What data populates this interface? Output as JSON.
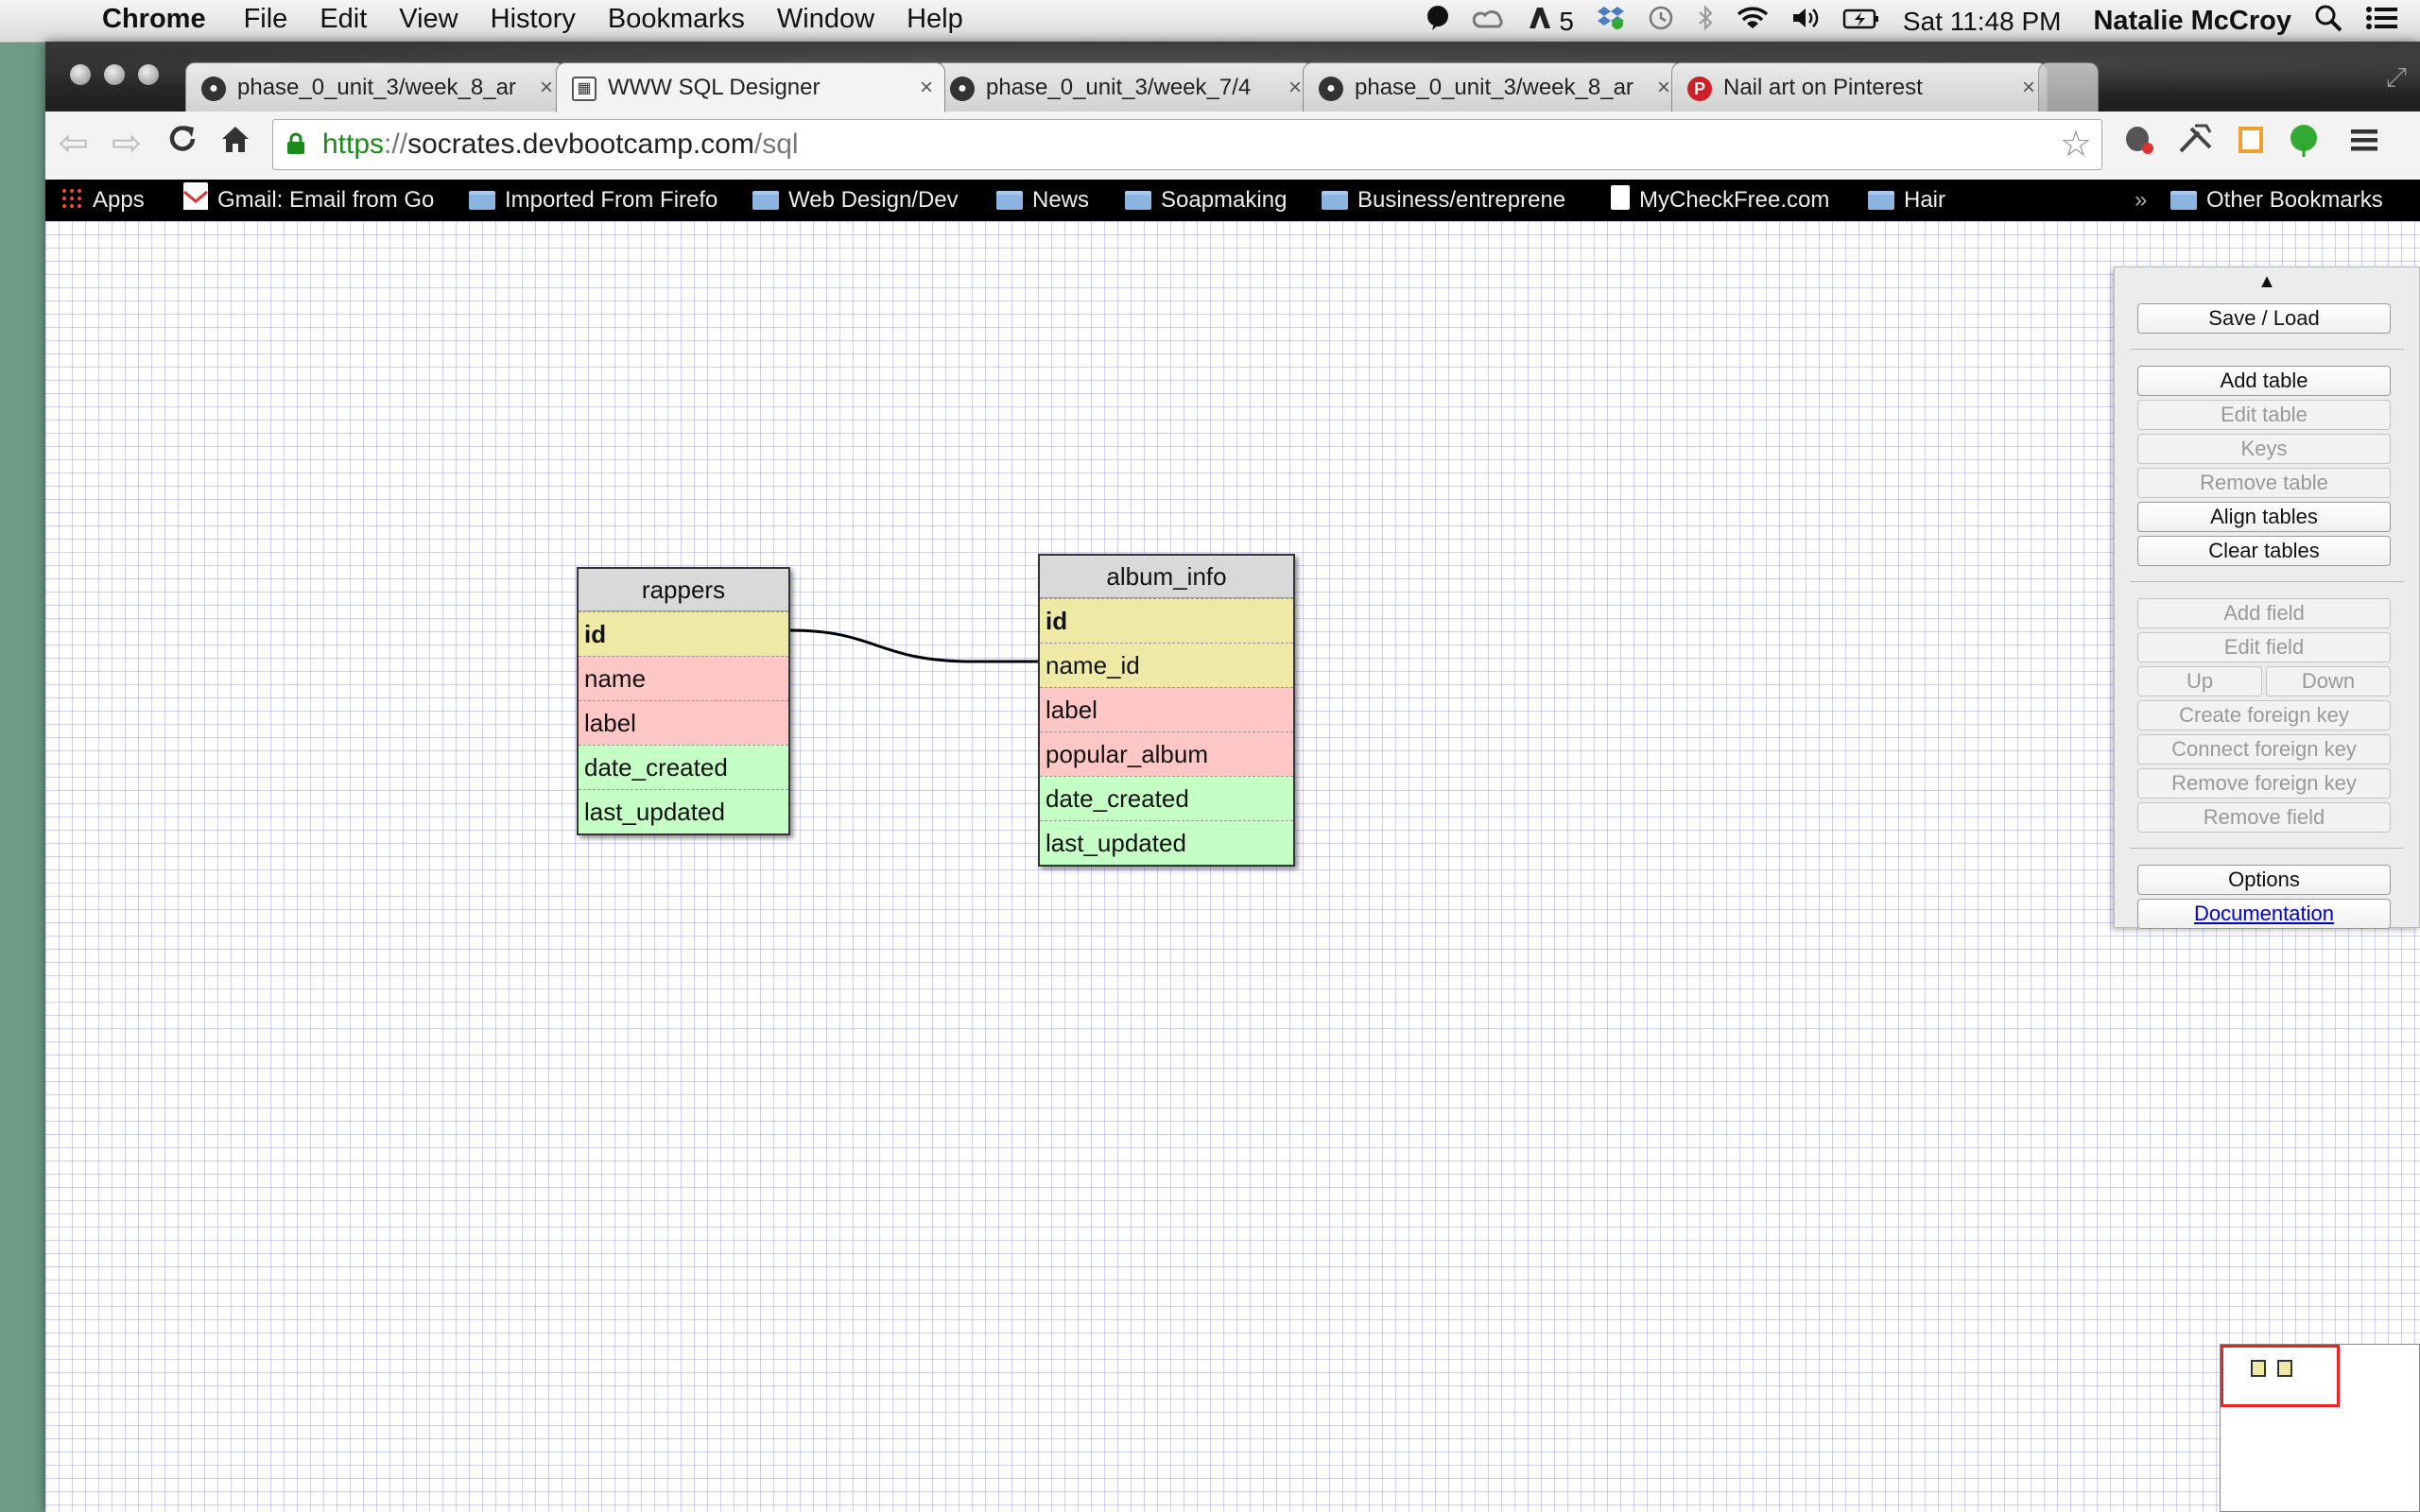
{
  "menubar": {
    "app": "Chrome",
    "menus": [
      "File",
      "Edit",
      "View",
      "History",
      "Bookmarks",
      "Window",
      "Help"
    ],
    "adobe_count": "5",
    "clock": "Sat 11:48 PM",
    "user": "Natalie McCroy"
  },
  "tabs": [
    {
      "title": "phase_0_unit_3/week_8_ar",
      "icon": "github-icon",
      "active": false
    },
    {
      "title": "WWW SQL Designer",
      "icon": "sql-designer-icon",
      "active": true
    },
    {
      "title": "phase_0_unit_3/week_7/4",
      "icon": "github-icon",
      "active": false
    },
    {
      "title": "phase_0_unit_3/week_8_ar",
      "icon": "github-icon",
      "active": false
    },
    {
      "title": "Nail art on Pinterest",
      "icon": "pinterest-icon",
      "active": false
    }
  ],
  "omnibox": {
    "scheme": "https",
    "separator": "://",
    "host": "socrates.devbootcamp.com",
    "path": "/sql"
  },
  "bookmarks": {
    "items": [
      {
        "label": "Apps",
        "icon": "apps-grid-icon"
      },
      {
        "label": "Gmail: Email from Go",
        "icon": "gmail-icon"
      },
      {
        "label": "Imported From Firefo",
        "icon": "folder-icon"
      },
      {
        "label": "Web Design/Dev",
        "icon": "folder-icon"
      },
      {
        "label": "News",
        "icon": "folder-icon"
      },
      {
        "label": "Soapmaking",
        "icon": "folder-icon"
      },
      {
        "label": "Business/entreprene",
        "icon": "folder-icon"
      },
      {
        "label": "MyCheckFree.com",
        "icon": "page-icon"
      },
      {
        "label": "Hair",
        "icon": "folder-icon"
      }
    ],
    "overflow": "»",
    "other": "Other Bookmarks"
  },
  "tables": [
    {
      "name": "rappers",
      "fields": [
        {
          "name": "id",
          "kind": "key"
        },
        {
          "name": "name",
          "kind": "text"
        },
        {
          "name": "label",
          "kind": "text"
        },
        {
          "name": "date_created",
          "kind": "date"
        },
        {
          "name": "last_updated",
          "kind": "date"
        }
      ]
    },
    {
      "name": "album_info",
      "fields": [
        {
          "name": "id",
          "kind": "key"
        },
        {
          "name": "name_id",
          "kind": "foreign"
        },
        {
          "name": "label",
          "kind": "text"
        },
        {
          "name": "popular_album",
          "kind": "text"
        },
        {
          "name": "date_created",
          "kind": "date"
        },
        {
          "name": "last_updated",
          "kind": "date"
        }
      ]
    }
  ],
  "panel": {
    "save_load": "Save / Load",
    "add_table": "Add table",
    "edit_table": "Edit table",
    "keys": "Keys",
    "remove_table": "Remove table",
    "align_tables": "Align tables",
    "clear_tables": "Clear tables",
    "add_field": "Add field",
    "edit_field": "Edit field",
    "up": "Up",
    "down": "Down",
    "create_fk": "Create foreign key",
    "connect_fk": "Connect foreign key",
    "remove_fk": "Remove foreign key",
    "remove_field": "Remove field",
    "options": "Options",
    "documentation": "Documentation"
  },
  "colors": {
    "key_field": "#eeeaa5",
    "text_field": "#ffc6c6",
    "date_field": "#c6ffc6"
  }
}
